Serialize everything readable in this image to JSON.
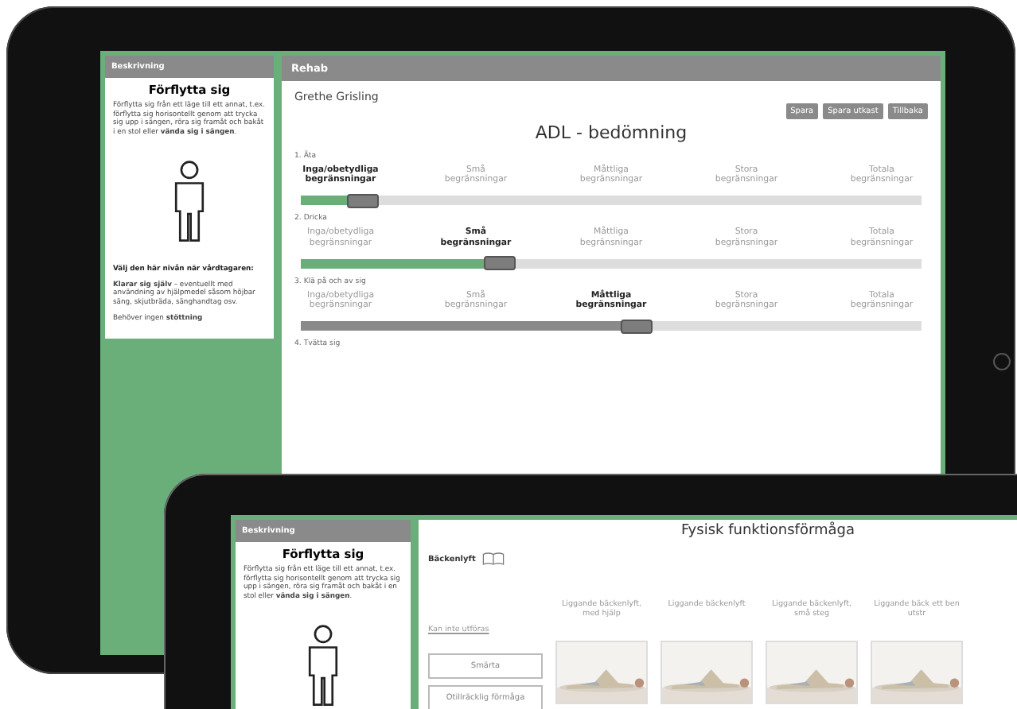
{
  "back_tablet": {
    "description": {
      "header": "Beskrivning",
      "title": "Förflytta sig",
      "text": "Förflytta sig från ett läge till ett annat, t.ex. förflytta sig horisontellt genom att trycka sig upp i sängen, röra sig framåt och bakåt i en stol eller **vända sig i sängen**.",
      "choose": "Välj den här nivån när vårdtagaren:",
      "level_text": "**Klarar sig själv** – eventuellt med användning av hjälpmedel såsom höjbar säng, skjutbräda, sänghandtag osv.",
      "support": "Behöver ingen **stöttning**"
    },
    "main": {
      "header": "Rehab",
      "patient": "Grethe Grisling",
      "buttons": [
        "Spara",
        "Spara utkast",
        "Tillbaka"
      ],
      "title": "ADL - bedömning",
      "items": [
        {
          "label": "1. Äta",
          "color": "#6aaf7a",
          "level": 0.08,
          "options": [
            {
              "text": "Inga/obetydliga begränsningar",
              "selected": true
            },
            {
              "text": "Små begränsningar",
              "selected": false
            },
            {
              "text": "Måttliga begränsningar",
              "selected": false
            },
            {
              "text": "Stora begränsningar",
              "selected": false
            },
            {
              "text": "Totala begränsningar",
              "selected": false
            }
          ]
        },
        {
          "label": "2. Dricka",
          "color": "#6aaf7a",
          "level": 0.3,
          "options": [
            {
              "text": "Inga/obetydliga begränsningar",
              "selected": false
            },
            {
              "text": "Små begränsningar",
              "selected": true
            },
            {
              "text": "Måttliga begränsningar",
              "selected": false
            },
            {
              "text": "Stora begränsningar",
              "selected": false
            },
            {
              "text": "Totala begränsningar",
              "selected": false
            }
          ]
        },
        {
          "label": "3. Klä på och av sig",
          "color": "#8a8a8a",
          "level": 0.52,
          "options": [
            {
              "text": "Inga/obetydliga begränsningar",
              "selected": false
            },
            {
              "text": "Små begränsningar",
              "selected": false
            },
            {
              "text": "Måttliga begränsningar",
              "selected": true
            },
            {
              "text": "Stora begränsningar",
              "selected": false
            },
            {
              "text": "Totala begränsningar",
              "selected": false
            }
          ]
        },
        {
          "label": "4. Tvätta sig"
        }
      ]
    }
  },
  "front_tablet": {
    "description": {
      "header": "Beskrivning",
      "title": "Förflytta sig",
      "text": "Förflytta sig från ett läge till ett annat, t.ex. förflytta sig horisontellt genom att trycka sig upp i sängen, röra sig framåt och bakåt i en stol eller **vända sig i sängen**."
    },
    "main": {
      "title": "Fysisk funktionsförmåga",
      "exercise": "Bäckenlyft",
      "cannot": "Kan inte utföras",
      "reasons": [
        "Smärta",
        "Otillräcklig förmåga"
      ],
      "levels": [
        {
          "text": "Liggande bäckenlyft, med hjälp",
          "kind": "picture"
        },
        {
          "text": "Liggande bäckenlyft",
          "kind": "picture"
        },
        {
          "text": "Liggande bäckenlyft, små steg",
          "kind": "picture"
        },
        {
          "text": "Liggande bäck ett ben utstr",
          "kind": "picture"
        }
      ]
    }
  }
}
